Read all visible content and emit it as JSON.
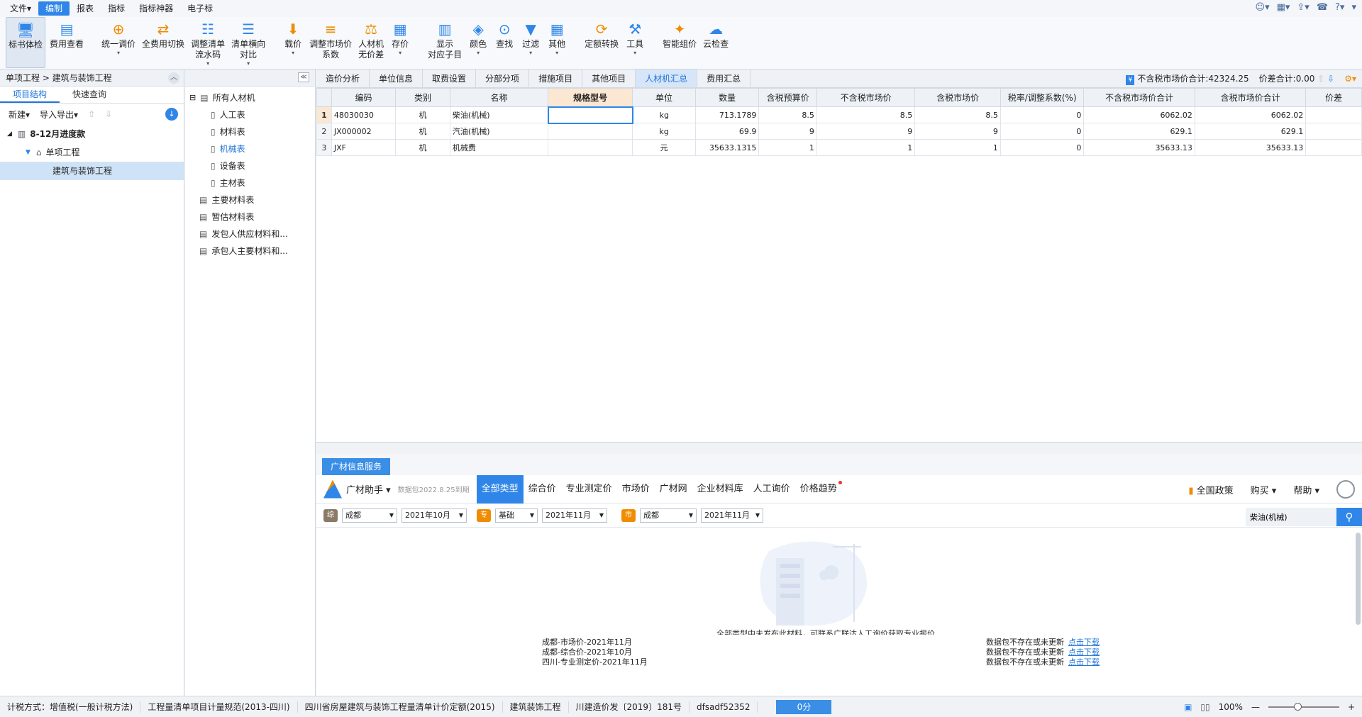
{
  "menu": {
    "items": [
      "文件▾",
      "编制",
      "报表",
      "指标",
      "指标神器",
      "电子标"
    ],
    "active_index": 1
  },
  "ribbon": {
    "buttons": [
      {
        "label": "标书体检",
        "icon": "monitor-check-icon",
        "color": "#2f86e8"
      },
      {
        "label": "费用查看",
        "icon": "fee-view-icon",
        "color": "#2f86e8"
      },
      {
        "label": "统一调价",
        "icon": "price-adjust-icon",
        "color": "#f08c00",
        "dropdown": true
      },
      {
        "label": "全费用切换",
        "icon": "switch-icon",
        "color": "#f08c00"
      },
      {
        "label": "调整清单\n流水码",
        "icon": "list-code-icon",
        "color": "#2f86e8",
        "dropdown": true
      },
      {
        "label": "清单横向\n对比",
        "icon": "compare-icon",
        "color": "#2f86e8",
        "dropdown": true
      },
      {
        "label": "载价",
        "icon": "load-price-icon",
        "color": "#f08c00",
        "dropdown": true
      },
      {
        "label": "调整市场价\n系数",
        "icon": "coefficient-icon",
        "color": "#f08c00"
      },
      {
        "label": "人材机\n无价差",
        "icon": "balance-icon",
        "color": "#f08c00"
      },
      {
        "label": "存价",
        "icon": "save-price-icon",
        "color": "#2f86e8",
        "dropdown": true
      },
      {
        "label": "显示\n对应子目",
        "icon": "show-sub-icon",
        "color": "#2f86e8"
      },
      {
        "label": "颜色",
        "icon": "paint-bucket-icon",
        "color": "#2f86e8",
        "dropdown": true
      },
      {
        "label": "查找",
        "icon": "binoculars-icon",
        "color": "#2f86e8"
      },
      {
        "label": "过滤",
        "icon": "filter-icon",
        "color": "#2f86e8",
        "dropdown": true
      },
      {
        "label": "其他",
        "icon": "grid-icon",
        "color": "#2f86e8",
        "dropdown": true
      },
      {
        "label": "定额转换",
        "icon": "quota-convert-icon",
        "color": "#f08c00"
      },
      {
        "label": "工具",
        "icon": "tool-icon",
        "color": "#2f86e8",
        "dropdown": true
      },
      {
        "label": "智能组价",
        "icon": "smart-price-icon",
        "color": "#f08c00"
      },
      {
        "label": "云检查",
        "icon": "cloud-check-icon",
        "color": "#2f86e8"
      }
    ]
  },
  "left": {
    "breadcrumb": "单项工程 > 建筑与装饰工程",
    "tabs": [
      "项目结构",
      "快速查询"
    ],
    "toolbar": {
      "new": "新建▾",
      "import_export": "导入导出▾"
    },
    "tree": [
      {
        "label": "8-12月进度款",
        "level": 0,
        "bold": true
      },
      {
        "label": "单项工程",
        "level": 1
      },
      {
        "label": "建筑与装饰工程",
        "level": 2,
        "selected": true
      }
    ]
  },
  "mid_tree": {
    "items": [
      {
        "label": "所有人材机",
        "level": 0,
        "expander": "⊟"
      },
      {
        "label": "人工表",
        "level": 1
      },
      {
        "label": "材料表",
        "level": 1
      },
      {
        "label": "机械表",
        "level": 1,
        "selected": true
      },
      {
        "label": "设备表",
        "level": 1
      },
      {
        "label": "主材表",
        "level": 1
      },
      {
        "label": "主要材料表",
        "level": 0
      },
      {
        "label": "暂估材料表",
        "level": 0
      },
      {
        "label": "发包人供应材料和...",
        "level": 0
      },
      {
        "label": "承包人主要材料和...",
        "level": 0
      }
    ]
  },
  "main_tabs": {
    "items": [
      "造价分析",
      "单位信息",
      "取费设置",
      "分部分项",
      "措施项目",
      "其他项目",
      "人材机汇总",
      "费用汇总"
    ],
    "active_index": 6,
    "sum_label": "不含税市场价合计:42324.25",
    "diff_label": "价差合计:0.00"
  },
  "grid": {
    "columns": [
      "",
      "编码",
      "类别",
      "名称",
      "规格型号",
      "单位",
      "数量",
      "含税预算价",
      "不含税市场价",
      "含税市场价",
      "税率/调整系数(%)",
      "不含税市场价合计",
      "含税市场价合计",
      "价差"
    ],
    "highlight_col": 4,
    "rows": [
      [
        "1",
        "48030030",
        "机",
        "柴油(机械)",
        "",
        "kg",
        "713.1789",
        "8.5",
        "8.5",
        "8.5",
        "0",
        "6062.02",
        "6062.02",
        ""
      ],
      [
        "2",
        "JX000002",
        "机",
        "汽油(机械)",
        "",
        "kg",
        "69.9",
        "9",
        "9",
        "9",
        "0",
        "629.1",
        "629.1",
        ""
      ],
      [
        "3",
        "JXF",
        "机",
        "机械费",
        "",
        "元",
        "35633.1315",
        "1",
        "1",
        "1",
        "0",
        "35633.13",
        "35633.13",
        ""
      ]
    ]
  },
  "info_panel": {
    "tab": "广材信息服务",
    "brand": "广材助手 ▾",
    "version": "数据包2022.8.25到期",
    "nav": [
      "全部类型",
      "综合价",
      "专业测定价",
      "市场价",
      "广材网",
      "企业材料库",
      "人工询价",
      "价格趋势"
    ],
    "nav_active": 0,
    "right": {
      "policy": "全国政策",
      "buy": "购买 ▾",
      "help": "帮助 ▾"
    },
    "filters": {
      "tag1": "综",
      "city1": "成都",
      "month1": "2021年10月",
      "tag2": "专",
      "base": "基础",
      "month2": "2021年11月",
      "tag3": "市",
      "city2": "成都",
      "month3": "2021年11月"
    },
    "search_value": "柴油(机械)",
    "empty_message": "全部类型中未发布此材料，可联系广联达人工询价获取专业报价",
    "packages": [
      {
        "name": "成都-市场价-2021年11月",
        "status": "数据包不存在或未更新",
        "link": "点击下载"
      },
      {
        "name": "成都-综合价-2021年10月",
        "status": "数据包不存在或未更新",
        "link": "点击下载"
      },
      {
        "name": "四川-专业测定价-2021年11月",
        "status": "数据包不存在或未更新",
        "link": "点击下载"
      }
    ]
  },
  "status_bar": {
    "items": [
      "计税方式：增值税(一般计税方法)",
      "工程量清单项目计量规范(2013-四川)",
      "四川省房屋建筑与装饰工程量清单计价定额(2015)",
      "建筑装饰工程",
      "川建造价发〔2019〕181号",
      "dfsadf52352"
    ],
    "score": "0分",
    "zoom": "100%"
  },
  "colors": {
    "accent": "#2f86e8",
    "orange": "#f08c00"
  }
}
